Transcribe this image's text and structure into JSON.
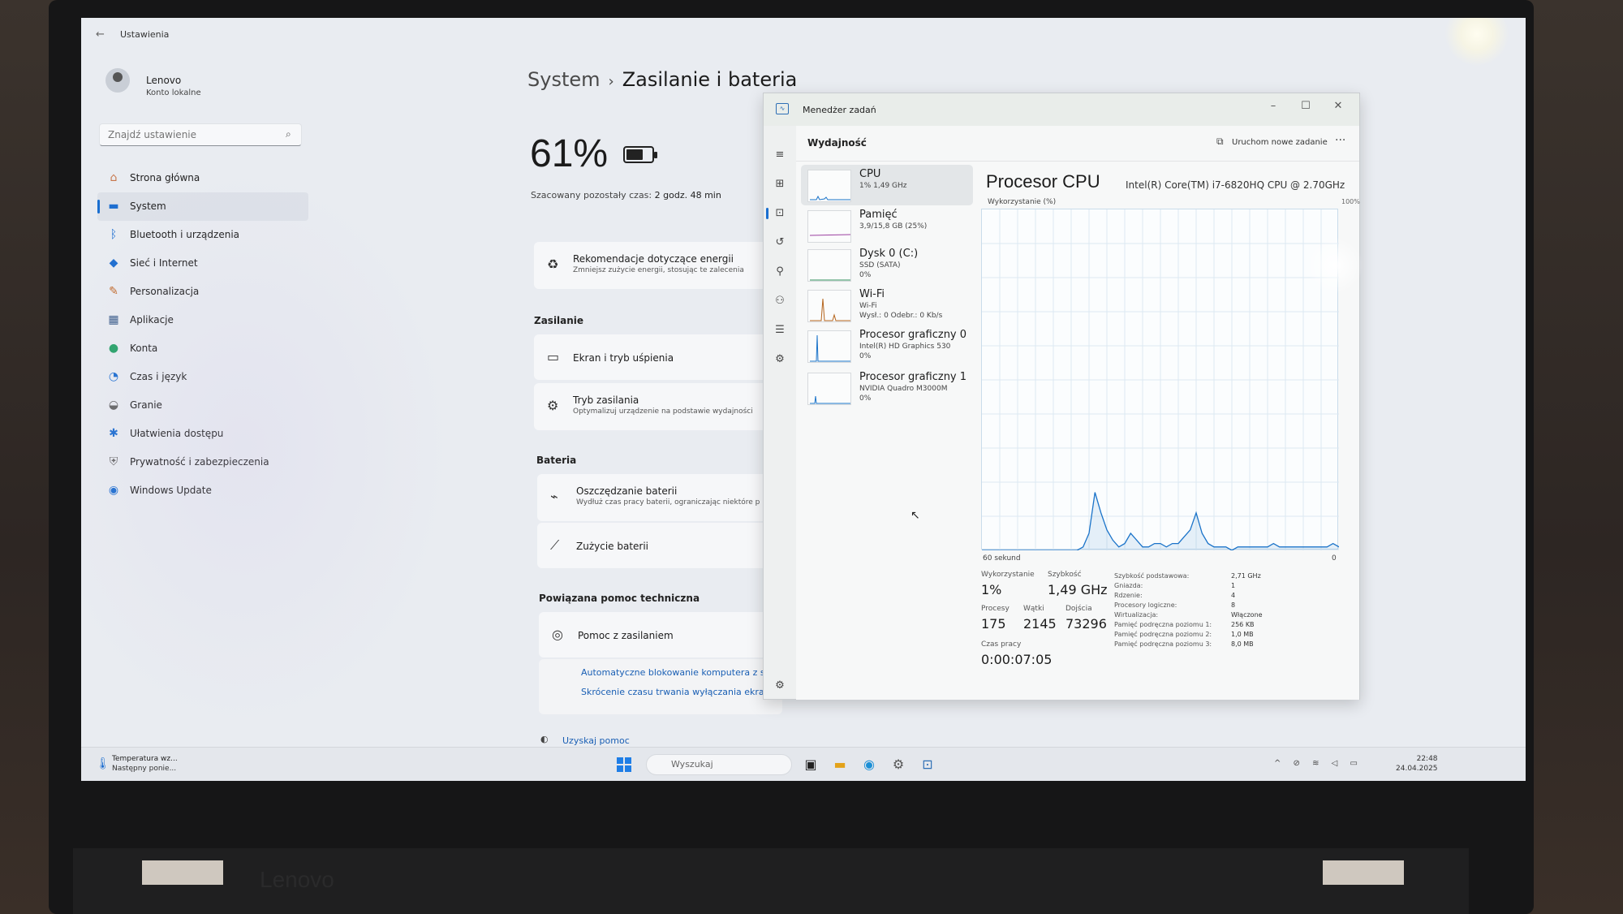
{
  "settings": {
    "app_title": "Ustawienia",
    "profile": {
      "name": "Lenovo",
      "account": "Konto lokalne"
    },
    "search_placeholder": "Znajdź ustawienie",
    "nav": [
      {
        "label": "Strona główna",
        "icon": "home-icon",
        "color": "#c7764a"
      },
      {
        "label": "System",
        "icon": "monitor-icon",
        "color": "#1f6fd0"
      },
      {
        "label": "Bluetooth i urządzenia",
        "icon": "bluetooth-icon",
        "color": "#1f6fd0"
      },
      {
        "label": "Sieć i Internet",
        "icon": "wifi-icon",
        "color": "#1f6fd0"
      },
      {
        "label": "Personalizacja",
        "icon": "brush-icon",
        "color": "#c26a2b"
      },
      {
        "label": "Aplikacje",
        "icon": "apps-icon",
        "color": "#3b5c8a"
      },
      {
        "label": "Konta",
        "icon": "person-icon",
        "color": "#2aa36a"
      },
      {
        "label": "Czas i język",
        "icon": "globe-clock-icon",
        "color": "#1f6fd0"
      },
      {
        "label": "Granie",
        "icon": "gamepad-icon",
        "color": "#666666"
      },
      {
        "label": "Ułatwienia dostępu",
        "icon": "accessibility-icon",
        "color": "#1f6fd0"
      },
      {
        "label": "Prywatność i zabezpieczenia",
        "icon": "shield-icon",
        "color": "#666666"
      },
      {
        "label": "Windows Update",
        "icon": "update-icon",
        "color": "#1f6fd0"
      }
    ],
    "breadcrumb": {
      "parent": "System",
      "separator": "›",
      "current": "Zasilanie i bateria"
    },
    "battery_percent": "61%",
    "estimate_label": "Szacowany pozostały czas:",
    "estimate_value": "2 godz. 48 min",
    "recommend": {
      "title": "Rekomendacje dotyczące energii",
      "subtitle": "Zmniejsz zużycie energii, stosując te zalecenia"
    },
    "power_section": "Zasilanie",
    "screen_sleep": "Ekran i tryb uśpienia",
    "power_mode": {
      "title": "Tryb zasilania",
      "subtitle": "Optymalizuj urządzenie na podstawie wydajności"
    },
    "battery_section": "Bateria",
    "battery_saver": {
      "title": "Oszczędzanie baterii",
      "subtitle": "Wydłuż czas pracy baterii, ograniczając niektóre p"
    },
    "battery_usage": "Zużycie baterii",
    "help_section": "Powiązana pomoc techniczna",
    "power_help": "Pomoc z zasilaniem",
    "link1": "Automatyczne blokowanie komputera z sy",
    "link2": "Skrócenie czasu trwania wyłączania ekranu",
    "get_help": "Uzyskaj pomoc"
  },
  "taskbar": {
    "weather_title": "Temperatura wz...",
    "weather_sub": "Następny ponie...",
    "search": "Wyszukaj",
    "tray": "^ ⊘ ≋ ◁ ▭",
    "time": "22:48",
    "date": "24.04.2025"
  },
  "taskmanager": {
    "title": "Menedżer zadań",
    "page": "Wydajność",
    "run_task": "Uruchom nowe zadanie",
    "more": "···",
    "items": [
      {
        "name": "CPU",
        "l1": "1% 1,49 GHz",
        "l2": ""
      },
      {
        "name": "Pamięć",
        "l1": "3,9/15,8 GB (25%)",
        "l2": ""
      },
      {
        "name": "Dysk 0 (C:)",
        "l1": "SSD (SATA)",
        "l2": "0%"
      },
      {
        "name": "Wi-Fi",
        "l1": "Wi-Fi",
        "l2": "Wysł.: 0 Odebr.: 0 Kb/s"
      },
      {
        "name": "Procesor graficzny 0",
        "l1": "Intel(R) HD Graphics 530",
        "l2": "0%"
      },
      {
        "name": "Procesor graficzny 1",
        "l1": "NVIDIA Quadro M3000M",
        "l2": "0%"
      }
    ],
    "detail": {
      "title": "Procesor CPU",
      "model": "Intel(R) Core(TM) i7-6820HQ CPU @ 2.70GHz",
      "util_label": "Wykorzystanie (%)",
      "max_label": "100%",
      "time_label": "60 sekund",
      "zero_label": "0",
      "stats": {
        "utilization_label": "Wykorzystanie",
        "utilization": "1%",
        "speed_label": "Szybkość",
        "speed": "1,49 GHz",
        "processes_label": "Procesy",
        "processes": "175",
        "threads_label": "Wątki",
        "threads": "2145",
        "handles_label": "Dojścia",
        "handles": "73296",
        "uptime_label": "Czas pracy",
        "uptime": "0:00:07:05"
      },
      "specs": [
        {
          "k": "Szybkość podstawowa:",
          "v": "2,71 GHz"
        },
        {
          "k": "Gniazda:",
          "v": "1"
        },
        {
          "k": "Rdzenie:",
          "v": "4"
        },
        {
          "k": "Procesory logiczne:",
          "v": "8"
        },
        {
          "k": "Wirtualizacja:",
          "v": "Włączone"
        },
        {
          "k": "Pamięć podręczna poziomu 1:",
          "v": "256 KB"
        },
        {
          "k": "Pamięć podręczna poziomu 2:",
          "v": "1,0 MB"
        },
        {
          "k": "Pamięć podręczna poziomu 3:",
          "v": "8,0 MB"
        }
      ]
    }
  },
  "chart_data": {
    "type": "line",
    "xlabel": "60 sekund",
    "ylabel": "Wykorzystanie (%)",
    "ylim": [
      0,
      100
    ],
    "xlim": [
      60,
      0
    ],
    "grid": true,
    "series": [
      {
        "values": [
          0,
          0,
          0,
          0,
          0,
          0,
          0,
          0,
          0,
          0,
          0,
          0,
          0,
          0,
          0,
          0,
          0,
          1,
          5,
          17,
          11,
          6,
          3,
          1,
          2,
          5,
          3,
          1,
          1,
          2,
          2,
          1,
          2,
          2,
          4,
          6,
          11,
          5,
          2,
          1,
          1,
          1,
          0,
          1,
          1,
          1,
          1,
          1,
          1,
          2,
          1,
          1,
          1,
          1,
          1,
          1,
          1,
          1,
          1,
          2,
          1
        ]
      }
    ]
  },
  "brand": "Lenovo"
}
